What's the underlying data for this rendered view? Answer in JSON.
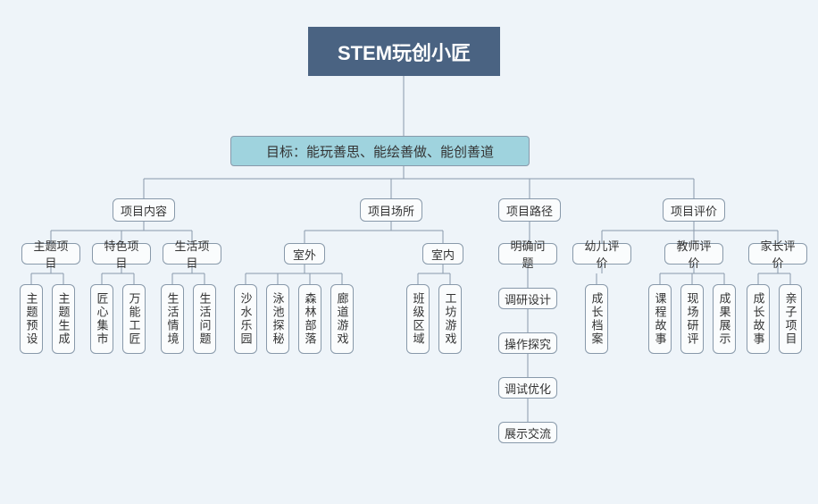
{
  "root": "STEM玩创小匠",
  "goal": "目标：能玩善思、能绘善做、能创善道",
  "categories": {
    "c1": "项目内容",
    "c2": "项目场所",
    "c3": "项目路径",
    "c4": "项目评价"
  },
  "subs": {
    "s1": "主题项目",
    "s2": "特色项目",
    "s3": "生活项目",
    "s4": "室外",
    "s5": "室内",
    "s6": "明确问题",
    "s7": "幼儿评价",
    "s8": "教师评价",
    "s9": "家长评价"
  },
  "leaves": {
    "l1": "主题预设",
    "l2": "主题生成",
    "l3": "匠心集市",
    "l4": "万能工匠",
    "l5": "生活情境",
    "l6": "生活问题",
    "l7": "沙水乐园",
    "l8": "泳池探秘",
    "l9": "森林部落",
    "l10": "廊道游戏",
    "l11": "班级区域",
    "l12": "工坊游戏",
    "l13": "成长档案",
    "l14": "课程故事",
    "l15": "现场研评",
    "l16": "成果展示",
    "l17": "成长故事",
    "l18": "亲子项目"
  },
  "chain": {
    "p1": "调研设计",
    "p2": "操作探究",
    "p3": "调试优化",
    "p4": "展示交流"
  },
  "chart_data": {
    "type": "tree",
    "title": "STEM玩创小匠",
    "root": "STEM玩创小匠",
    "children": [
      {
        "name": "目标：能玩善思、能绘善做、能创善道",
        "children": [
          {
            "name": "项目内容",
            "children": [
              {
                "name": "主题项目",
                "children": [
                  "主题预设",
                  "主题生成"
                ]
              },
              {
                "name": "特色项目",
                "children": [
                  "匠心集市",
                  "万能工匠"
                ]
              },
              {
                "name": "生活项目",
                "children": [
                  "生活情境",
                  "生活问题"
                ]
              }
            ]
          },
          {
            "name": "项目场所",
            "children": [
              {
                "name": "室外",
                "children": [
                  "沙水乐园",
                  "泳池探秘",
                  "森林部落",
                  "廊道游戏"
                ]
              },
              {
                "name": "室内",
                "children": [
                  "班级区域",
                  "工坊游戏"
                ]
              }
            ]
          },
          {
            "name": "项目路径",
            "children": [
              {
                "name": "明确问题",
                "sequence": [
                  "调研设计",
                  "操作探究",
                  "调试优化",
                  "展示交流"
                ]
              }
            ]
          },
          {
            "name": "项目评价",
            "children": [
              {
                "name": "幼儿评价",
                "children": [
                  "成长档案"
                ]
              },
              {
                "name": "教师评价",
                "children": [
                  "课程故事",
                  "现场研评",
                  "成果展示"
                ]
              },
              {
                "name": "家长评价",
                "children": [
                  "成长故事",
                  "亲子项目"
                ]
              }
            ]
          }
        ]
      }
    ]
  }
}
